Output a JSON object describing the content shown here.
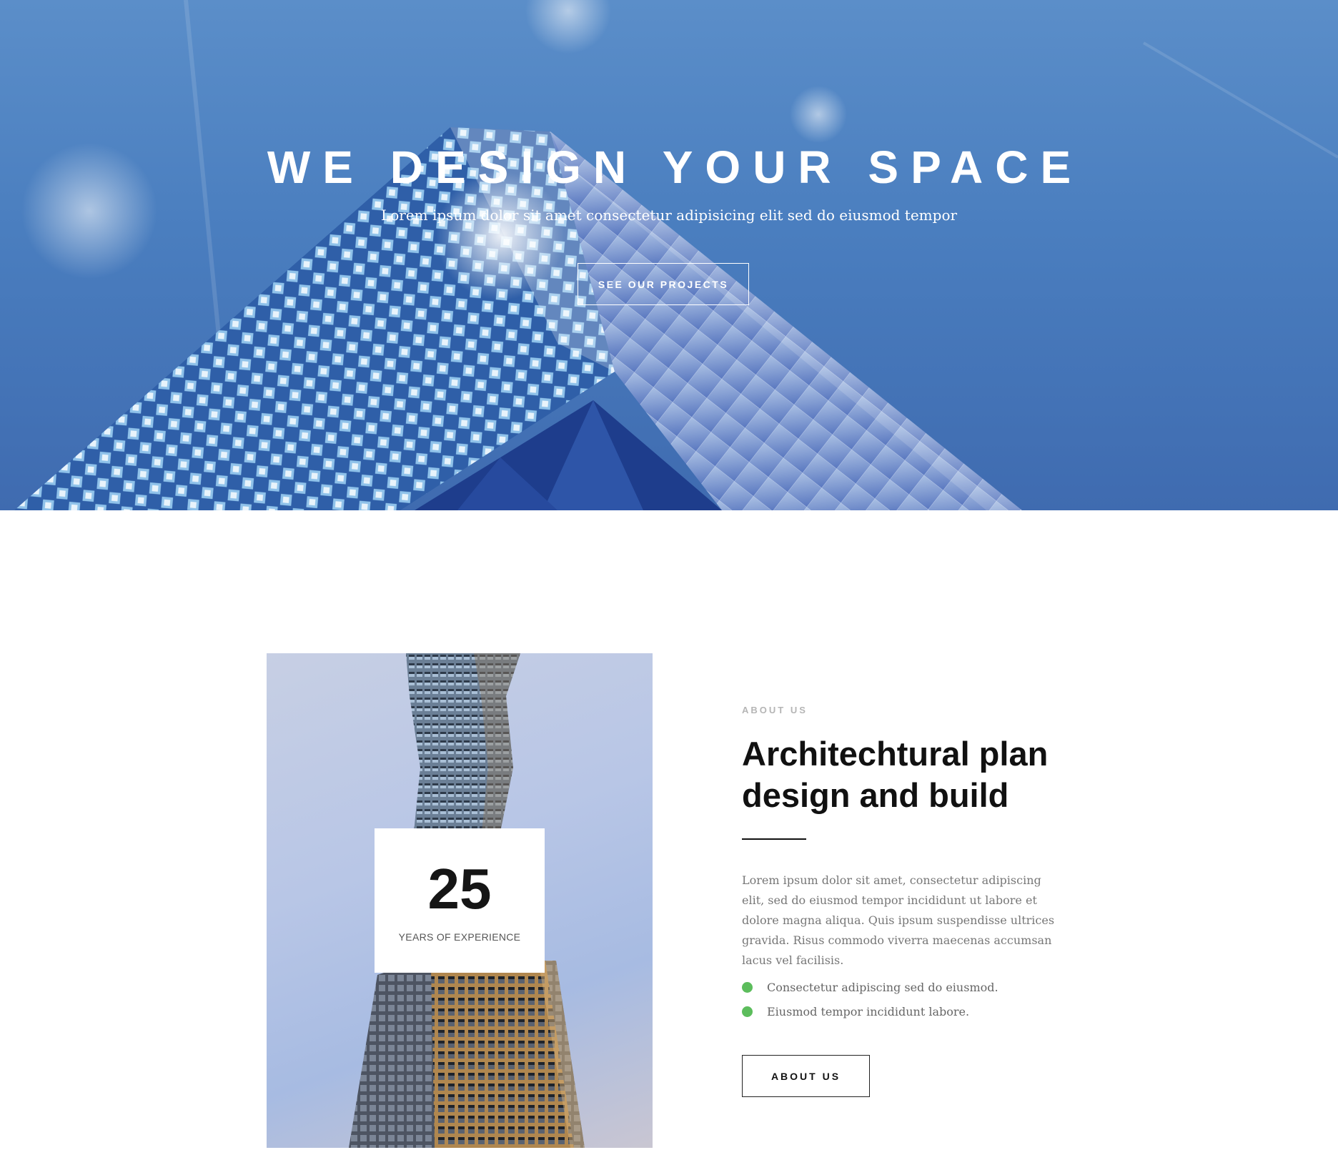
{
  "colors": {
    "hero_sky": "#4a7ebf",
    "accent_dot": "#5cbd5c",
    "heading_text": "#111111",
    "muted_text": "#777777",
    "eyebrow_text": "#b5b5b5"
  },
  "hero": {
    "title": "WE DESIGN YOUR SPACE",
    "subtitle": "Lorem ipsum dolor sit amet consectetur adipisicing elit sed do eiusmod tempor",
    "cta_label": "SEE OUR PROJECTS"
  },
  "about": {
    "eyebrow": "ABOUT US",
    "heading": "Architechtural plan design and build",
    "paragraph": "Lorem ipsum dolor sit amet, consectetur adipiscing elit, sed do eiusmod tempor incididunt ut labore et dolore magna aliqua. Quis ipsum suspendisse ultrices gravida. Risus commodo viverra maecenas accumsan lacus vel facilisis.",
    "bullets": [
      {
        "text": "Consectetur adipiscing sed do eiusmod."
      },
      {
        "text": "Eiusmod tempor incididunt labore."
      }
    ],
    "button_label": "ABOUT US",
    "stat": {
      "number": "25",
      "label": "YEARS OF EXPERIENCE"
    }
  }
}
